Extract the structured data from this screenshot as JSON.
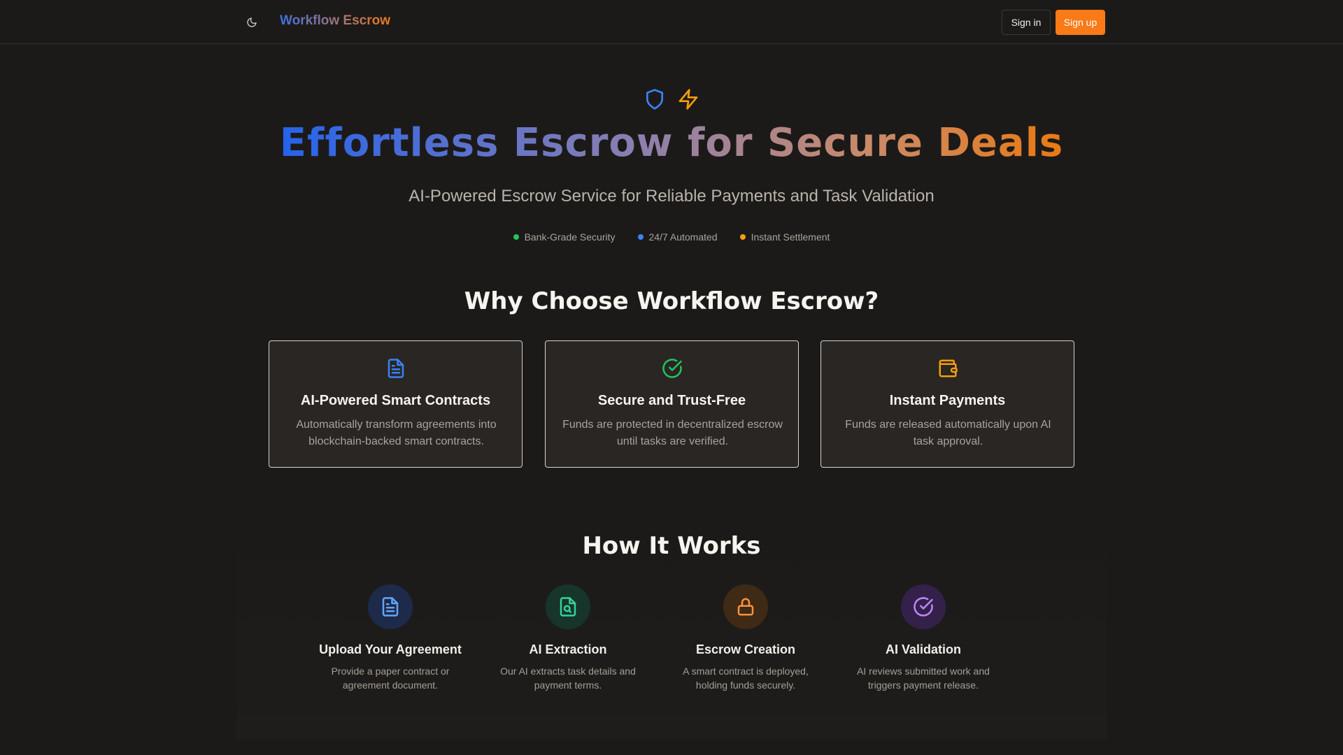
{
  "header": {
    "brand": "Workflow Escrow",
    "signin_label": "Sign in",
    "signup_label": "Sign up",
    "theme_icon": "moon-icon"
  },
  "hero": {
    "icons": [
      "shield-icon",
      "lightning-icon"
    ],
    "title": "Effortless Escrow for Secure Deals",
    "subtitle": "AI-Powered Escrow Service for Reliable Payments and Task Validation",
    "badges": [
      {
        "label": "Bank-Grade Security",
        "color": "#22c55e"
      },
      {
        "label": "24/7 Automated",
        "color": "#3b82f6"
      },
      {
        "label": "Instant Settlement",
        "color": "#f59e0b"
      }
    ]
  },
  "why": {
    "title": "Why Choose Workflow Escrow?",
    "cards": [
      {
        "icon": "document-icon",
        "icon_color": "#3b82f6",
        "title": "AI-Powered Smart Contracts",
        "text": "Automatically transform agreements into blockchain-backed smart contracts."
      },
      {
        "icon": "check-circle-icon",
        "icon_color": "#22c55e",
        "title": "Secure and Trust-Free",
        "text": "Funds are protected in decentralized escrow until tasks are verified."
      },
      {
        "icon": "wallet-icon",
        "icon_color": "#f59e0b",
        "title": "Instant Payments",
        "text": "Funds are released automatically upon AI task approval."
      }
    ]
  },
  "how": {
    "title": "How It Works",
    "steps": [
      {
        "icon": "document-icon",
        "color": "#60a5fa",
        "bg": "#1e2a4a",
        "title": "Upload Your Agreement",
        "text": "Provide a paper contract or agreement document."
      },
      {
        "icon": "file-search-icon",
        "color": "#34d399",
        "bg": "#17352a",
        "title": "AI Extraction",
        "text": "Our AI extracts task details and payment terms."
      },
      {
        "icon": "lock-icon",
        "color": "#fb923c",
        "bg": "#3f2a16",
        "title": "Escrow Creation",
        "text": "A smart contract is deployed, holding funds securely."
      },
      {
        "icon": "check-circle-icon",
        "color": "#c084fc",
        "bg": "#33214a",
        "title": "AI Validation",
        "text": "AI reviews submitted work and triggers payment release."
      }
    ]
  }
}
